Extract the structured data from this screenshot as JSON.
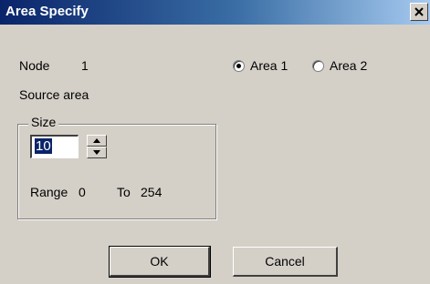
{
  "window": {
    "title": "Area Specify",
    "close_icon": "close-icon"
  },
  "node": {
    "label": "Node",
    "value": "1"
  },
  "source_area_label": "Source area",
  "area_options": {
    "selected": "Area 1",
    "area1_label": "Area 1",
    "area2_label": "Area 2"
  },
  "size_group": {
    "legend": "Size",
    "value": "10",
    "range_label": "Range",
    "range_from": "0",
    "to_label": "To",
    "range_to": "254",
    "spin_up_icon": "spin-up-icon",
    "spin_down_icon": "spin-down-icon"
  },
  "buttons": {
    "ok_label": "OK",
    "cancel_label": "Cancel"
  }
}
